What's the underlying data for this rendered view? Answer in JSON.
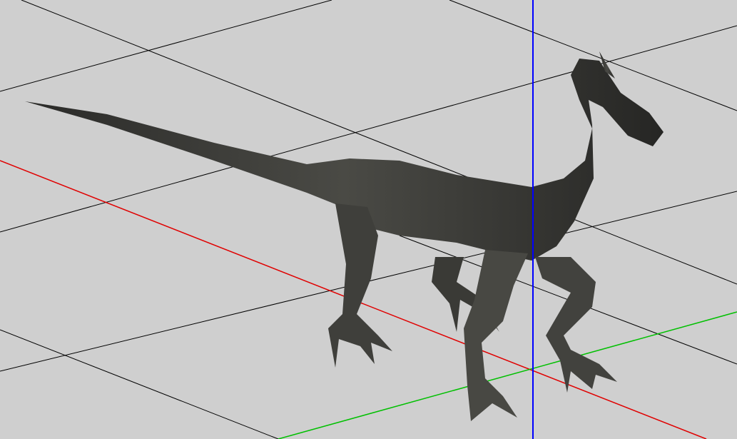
{
  "viewport": {
    "background": "#cfcfcf",
    "grid_color": "#000000",
    "axis_x_color": "#ff0000",
    "axis_y_color": "#00c800",
    "axis_z_color": "#0000ff",
    "model_color": "#3a3a36",
    "model": "raptor-dinosaur"
  }
}
